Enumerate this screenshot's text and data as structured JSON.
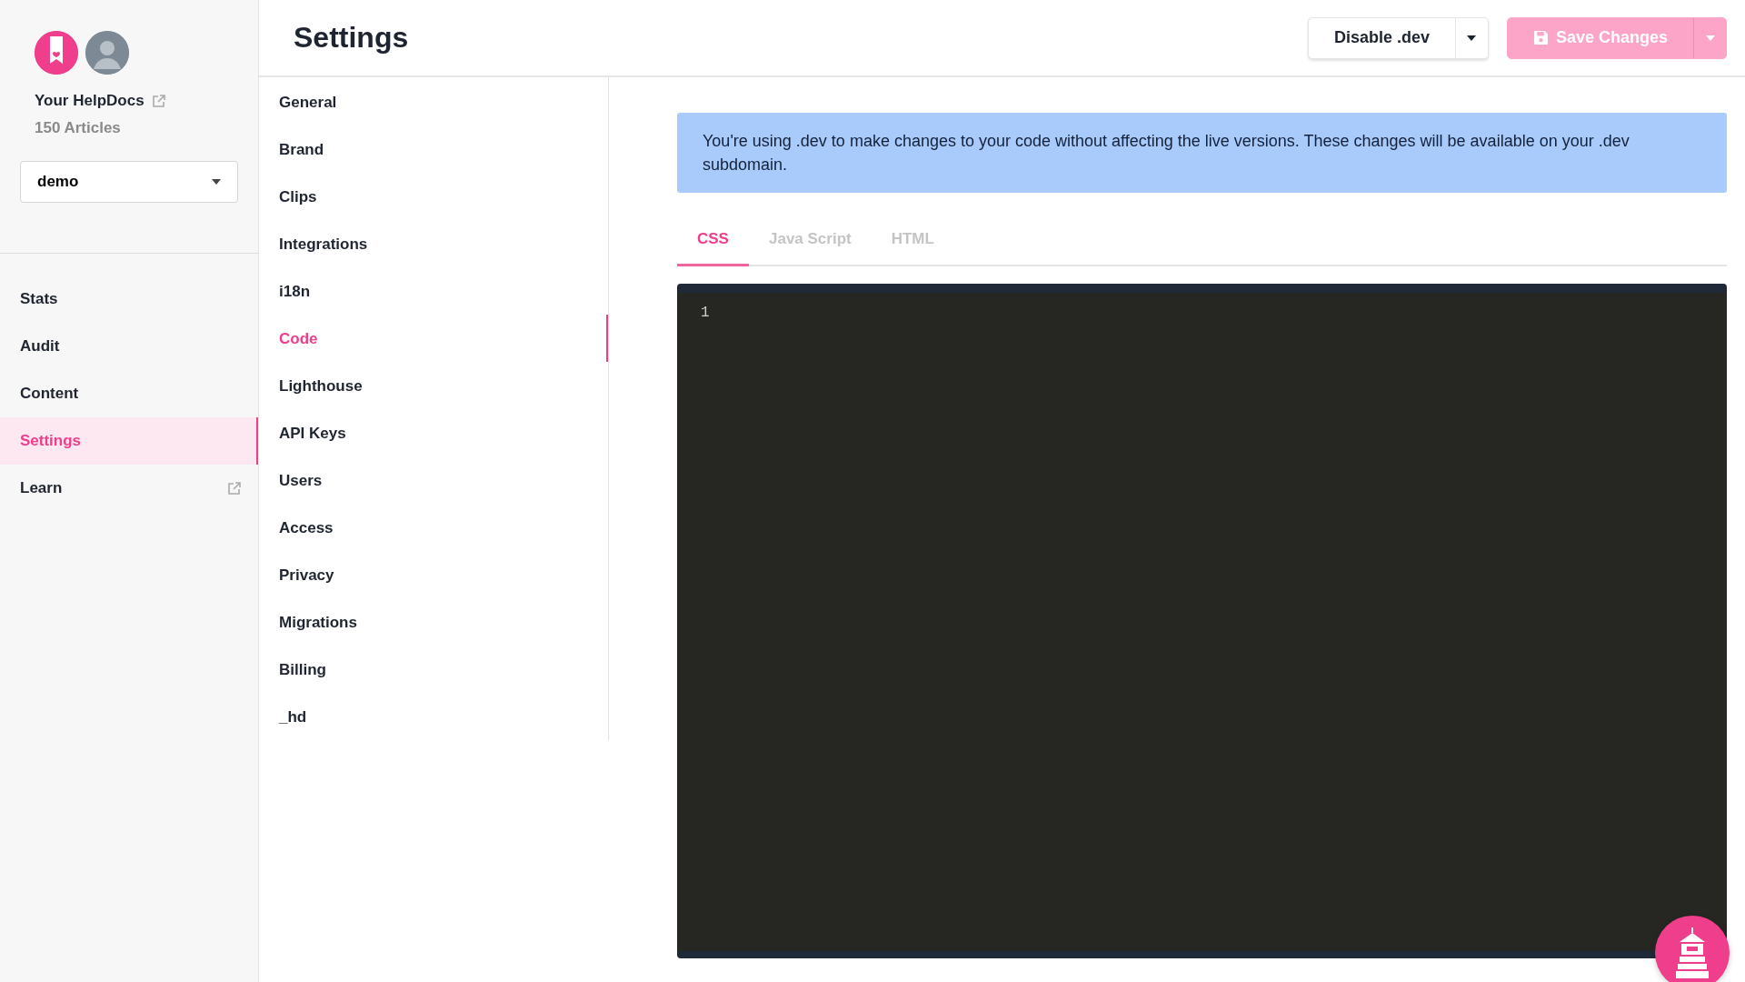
{
  "sidebar": {
    "account_name": "Your HelpDocs",
    "article_count": "150 Articles",
    "workspace_select": {
      "value": "demo"
    },
    "items": [
      {
        "label": "Stats",
        "selected": false,
        "external": false
      },
      {
        "label": "Audit",
        "selected": false,
        "external": false
      },
      {
        "label": "Content",
        "selected": false,
        "external": false
      },
      {
        "label": "Settings",
        "selected": true,
        "external": false
      },
      {
        "label": "Learn",
        "selected": false,
        "external": true
      }
    ]
  },
  "header": {
    "title": "Settings",
    "buttons": [
      {
        "label": "Disable .dev",
        "kind": "plain",
        "disabled": false
      },
      {
        "label": "Save Changes",
        "kind": "primary",
        "disabled": true
      }
    ]
  },
  "settings_nav": [
    {
      "label": "General",
      "selected": false
    },
    {
      "label": "Brand",
      "selected": false
    },
    {
      "label": "Clips",
      "selected": false
    },
    {
      "label": "Integrations",
      "selected": false
    },
    {
      "label": "i18n",
      "selected": false
    },
    {
      "label": "Code",
      "selected": true
    },
    {
      "label": "Lighthouse",
      "selected": false
    },
    {
      "label": "API Keys",
      "selected": false
    },
    {
      "label": "Users",
      "selected": false
    },
    {
      "label": "Access",
      "selected": false
    },
    {
      "label": "Privacy",
      "selected": false
    },
    {
      "label": "Migrations",
      "selected": false
    },
    {
      "label": "Billing",
      "selected": false
    },
    {
      "label": "_hd",
      "selected": false
    }
  ],
  "notice": "You're using .dev to make changes to your code without affecting the live versions. These changes will be available on your .dev subdomain.",
  "tabs": [
    {
      "label": "CSS",
      "selected": true
    },
    {
      "label": "Java Script",
      "selected": false
    },
    {
      "label": "HTML",
      "selected": false
    }
  ],
  "editor": {
    "line_numbers": [
      "1"
    ]
  }
}
